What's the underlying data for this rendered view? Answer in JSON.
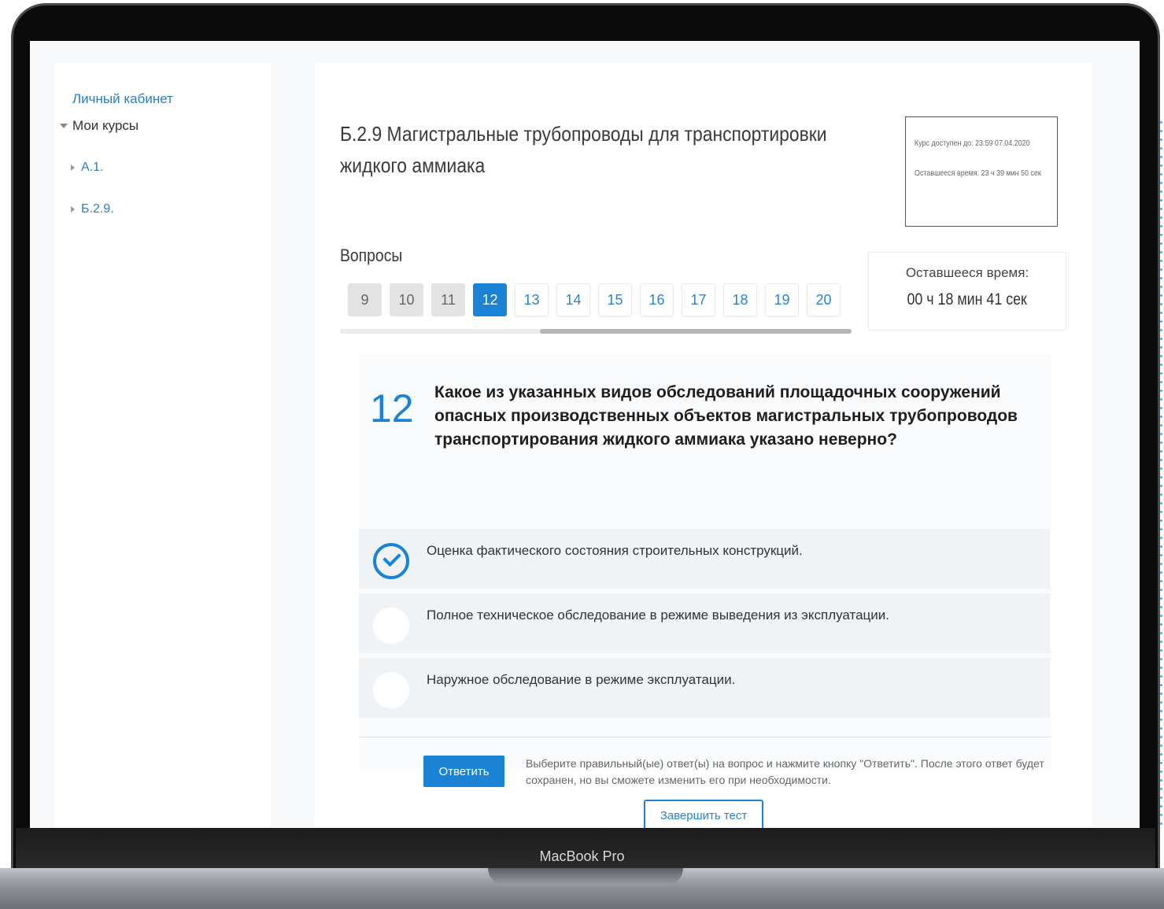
{
  "device": {
    "brand": "MacBook Pro"
  },
  "sidebar": {
    "top_link": "Личный кабинет",
    "my_courses": "Мои курсы",
    "items": [
      {
        "label": "А.1."
      },
      {
        "label": "Б.2.9."
      }
    ]
  },
  "course": {
    "title": "Б.2.9 Магистральные трубопроводы для транспортировки жидкого аммиака",
    "available_until": "Курс доступен до: 23:59 07.04.2020",
    "remaining": "Оставшееся время: 23 ч 39 мин 50 сек"
  },
  "questions_nav": {
    "label": "Вопросы",
    "items": [
      {
        "label": "9",
        "state": "done"
      },
      {
        "label": "10",
        "state": "done"
      },
      {
        "label": "11",
        "state": "done"
      },
      {
        "label": "12",
        "state": "current"
      },
      {
        "label": "13",
        "state": "todo"
      },
      {
        "label": "14",
        "state": "todo"
      },
      {
        "label": "15",
        "state": "todo"
      },
      {
        "label": "16",
        "state": "todo"
      },
      {
        "label": "17",
        "state": "todo"
      },
      {
        "label": "18",
        "state": "todo"
      },
      {
        "label": "19",
        "state": "todo"
      },
      {
        "label": "20",
        "state": "todo"
      }
    ]
  },
  "timer": {
    "label": "Оставшееся время:",
    "value": "00 ч 18 мин 41 сек"
  },
  "question": {
    "number": "12",
    "text": "Какое из указанных видов обследований площадочных сооружений опасных производственных объектов магистральных трубопроводов транспортирования жидкого аммиака указано неверно?",
    "answers": [
      {
        "text": "Оценка фактического состояния строительных конструкций.",
        "checked": true
      },
      {
        "text": "Полное техническое обследование в режиме выведения из эксплуатации.",
        "checked": false
      },
      {
        "text": "Наружное обследование в режиме эксплуатации.",
        "checked": false
      }
    ],
    "submit_label": "Ответить",
    "hint": "Выберите правильный(ые) ответ(ы) на вопрос и нажмите кнопку \"Ответить\". После этого ответ будет сохранен, но вы сможете изменить его при необходимости."
  },
  "finish_label": "Завершить тест",
  "colors": {
    "accent": "#1a83d6",
    "link": "#2a7fc4"
  }
}
